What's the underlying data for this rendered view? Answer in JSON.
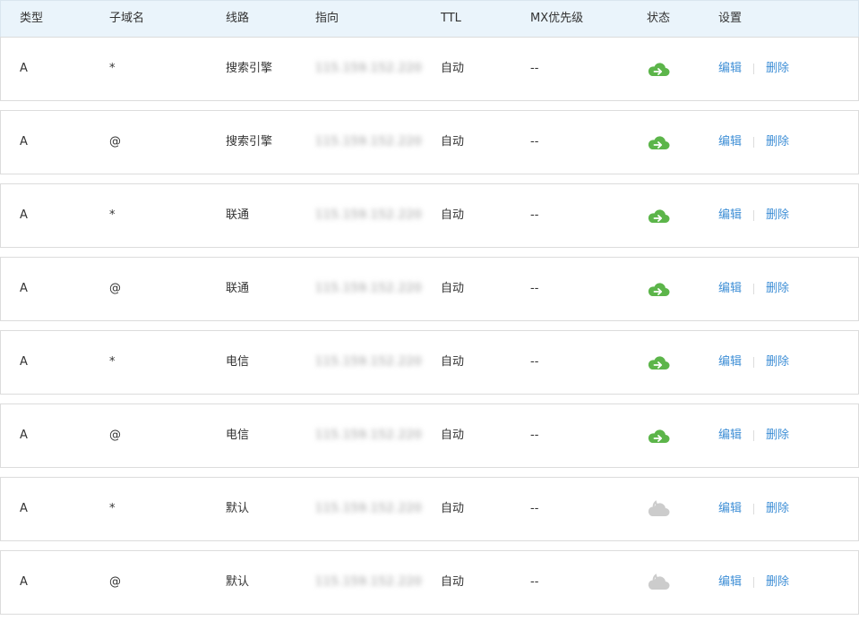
{
  "header": {
    "type": "类型",
    "subdomain": "子域名",
    "line": "线路",
    "target": "指向",
    "ttl": "TTL",
    "mx": "MX优先级",
    "status": "状态",
    "settings": "设置"
  },
  "actions": {
    "edit": "编辑",
    "delete": "删除"
  },
  "status_colors": {
    "enabled": "#5cb54a",
    "paused": "#cccccc"
  },
  "rows": [
    {
      "type": "A",
      "subdomain": "*",
      "line": "搜索引擎",
      "target": "115.159.152.220",
      "ttl": "自动",
      "mx": "--",
      "status": "enabled"
    },
    {
      "type": "A",
      "subdomain": "@",
      "line": "搜索引擎",
      "target": "115.159.152.220",
      "ttl": "自动",
      "mx": "--",
      "status": "enabled"
    },
    {
      "type": "A",
      "subdomain": "*",
      "line": "联通",
      "target": "115.159.152.220",
      "ttl": "自动",
      "mx": "--",
      "status": "enabled"
    },
    {
      "type": "A",
      "subdomain": "@",
      "line": "联通",
      "target": "115.159.152.220",
      "ttl": "自动",
      "mx": "--",
      "status": "enabled"
    },
    {
      "type": "A",
      "subdomain": "*",
      "line": "电信",
      "target": "115.159.152.220",
      "ttl": "自动",
      "mx": "--",
      "status": "enabled"
    },
    {
      "type": "A",
      "subdomain": "@",
      "line": "电信",
      "target": "115.159.152.220",
      "ttl": "自动",
      "mx": "--",
      "status": "enabled"
    },
    {
      "type": "A",
      "subdomain": "*",
      "line": "默认",
      "target": "115.159.152.220",
      "ttl": "自动",
      "mx": "--",
      "status": "paused"
    },
    {
      "type": "A",
      "subdomain": "@",
      "line": "默认",
      "target": "115.159.152.220",
      "ttl": "自动",
      "mx": "--",
      "status": "paused"
    }
  ]
}
